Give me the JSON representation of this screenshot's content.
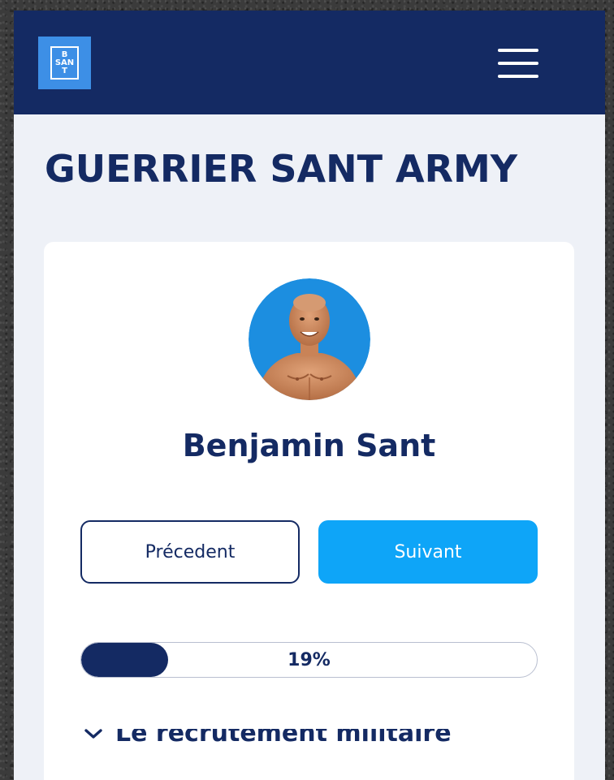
{
  "brand": {
    "logo_lines": [
      "B",
      "SAN",
      "T"
    ]
  },
  "header": {
    "menu_icon": "hamburger-menu-icon"
  },
  "page": {
    "title": "GUERRIER SANT ARMY"
  },
  "coach": {
    "name": "Benjamin Sant"
  },
  "navigation": {
    "prev_label": "Précedent",
    "next_label": "Suivant"
  },
  "progress": {
    "percent": 19,
    "label": "19%"
  },
  "chapter": {
    "label": "Le recrutement militaire",
    "icon": "chevron-down-icon"
  },
  "colors": {
    "navy": "#142a63",
    "accent_blue": "#0ea5f8",
    "logo_blue": "#3d8fe6",
    "page_bg": "#eef1f7"
  }
}
